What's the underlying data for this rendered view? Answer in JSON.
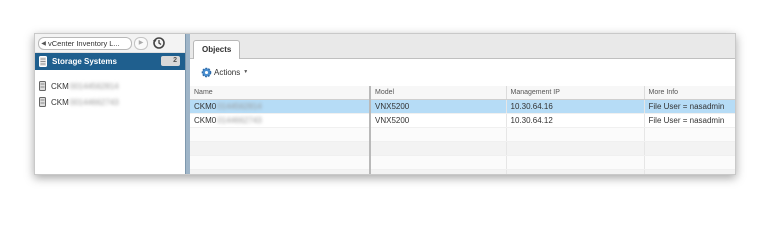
{
  "nav": {
    "back_label": "vCenter Inventory L...",
    "back_arrow": "◀",
    "forward_arrow": "▶",
    "history_icon": "history-icon"
  },
  "left_pane": {
    "section_title": "Storage Systems",
    "section_count": "2",
    "items": [
      {
        "prefix": "CKM",
        "blurred": "00144562814"
      },
      {
        "prefix": "CKM",
        "blurred": "00144662743"
      }
    ]
  },
  "right_pane": {
    "tab_label": "Objects",
    "actions_label": "Actions",
    "columns": [
      "Name",
      "Model",
      "Management IP",
      "More Info"
    ],
    "rows": [
      {
        "name_prefix": "CKM0",
        "name_blurred": "0144562814",
        "model": "VNX5200",
        "ip": "10.30.64.16",
        "info": "File User = nasadmin",
        "selected": true
      },
      {
        "name_prefix": "CKM0",
        "name_blurred": "0144662743",
        "model": "VNX5200",
        "ip": "10.30.64.12",
        "info": "File User = nasadmin",
        "selected": false
      }
    ]
  },
  "colors": {
    "section_header": "#1f5f8e",
    "row_selected": "#b6dcf6",
    "pane_divider": "#9fb5c8"
  }
}
